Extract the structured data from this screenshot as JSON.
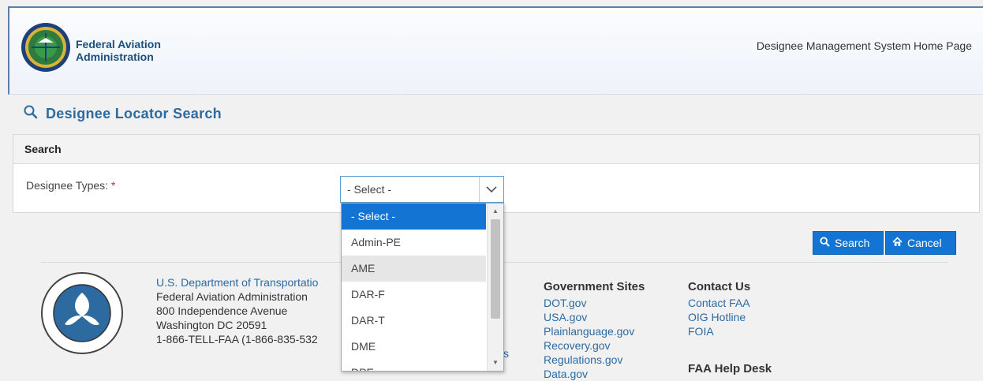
{
  "header": {
    "brand_line1": "Federal Aviation",
    "brand_line2": "Administration",
    "home_link": "Designee Management System Home Page"
  },
  "page": {
    "title": "Designee Locator Search",
    "panel_title": "Search",
    "field_label": "Designee Types:",
    "required_mark": "*",
    "select_value": "- Select -"
  },
  "dropdown": {
    "options": [
      "- Select -",
      "Admin-PE",
      "AME",
      "DAR-F",
      "DAR-T",
      "DME",
      "DPE"
    ],
    "selected_index": 0,
    "hover_index": 2
  },
  "buttons": {
    "search": "Search",
    "cancel": "Cancel"
  },
  "footer": {
    "dept": "U.S. Department of Transportatio",
    "agency": "Federal Aviation Administration",
    "street": "800 Independence Avenue",
    "city": "Washington DC 20591",
    "phone": "1-866-TELL-FAA (1-866-835-532",
    "gov_sites": {
      "heading": "Government Sites",
      "links": [
        "DOT.gov",
        "USA.gov",
        "Plainlanguage.gov",
        "Recovery.gov",
        "Regulations.gov",
        "Data.gov"
      ]
    },
    "contact": {
      "heading": "Contact Us",
      "links": [
        "Contact FAA",
        "OIG Hotline",
        "FOIA"
      ]
    },
    "help_desk": "FAA Help Desk",
    "stray_link_fragment": "s"
  },
  "colors": {
    "accent": "#1474d4",
    "title_blue": "#2c6aa0"
  }
}
